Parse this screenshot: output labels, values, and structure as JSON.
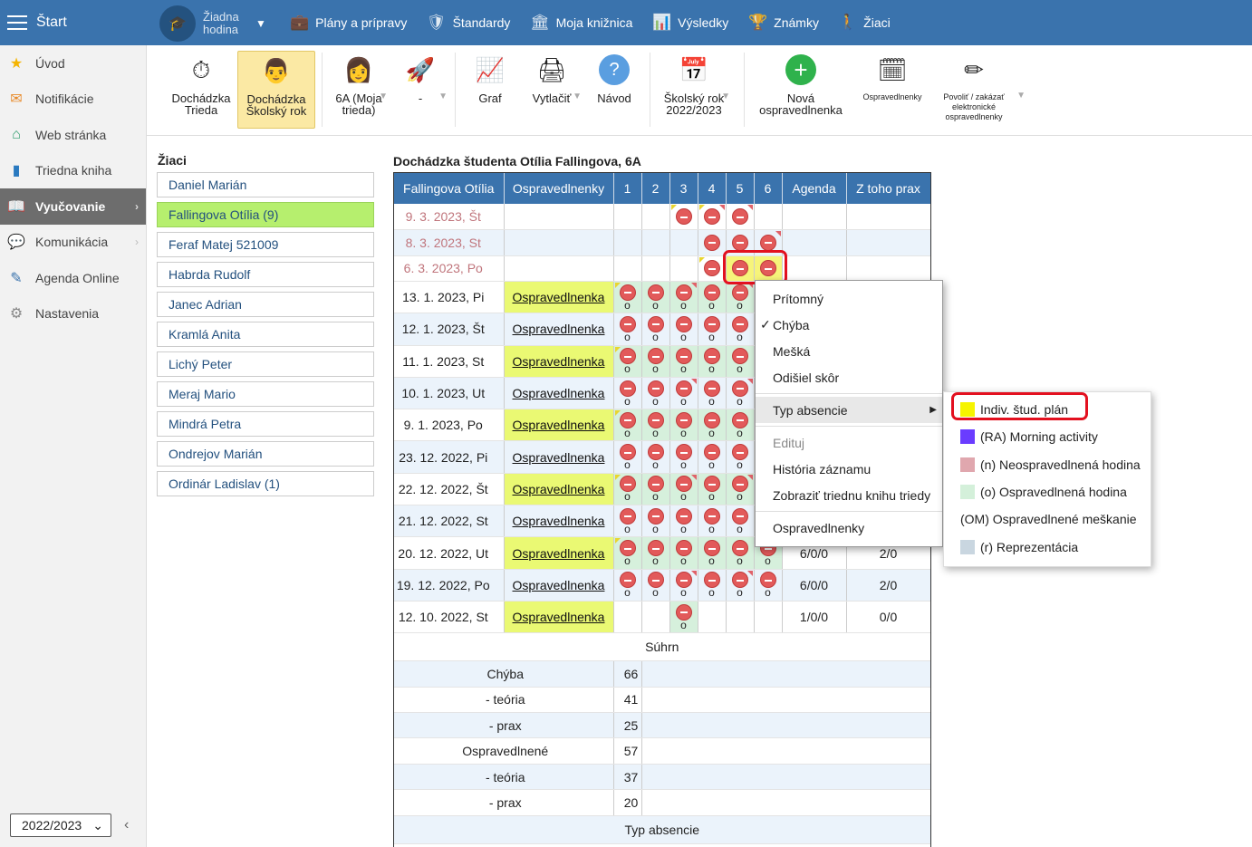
{
  "topbar": {
    "start_label": "Štart",
    "lesson_label": "Žiadna hodina",
    "nav": [
      {
        "label": "Plány a prípravy",
        "icon": "briefcase-icon"
      },
      {
        "label": "Štandardy",
        "icon": "shield-icon"
      },
      {
        "label": "Moja knižnica",
        "icon": "library-icon"
      },
      {
        "label": "Výsledky",
        "icon": "bar-chart-icon"
      },
      {
        "label": "Známky",
        "icon": "grades-icon"
      },
      {
        "label": "Žiaci",
        "icon": "students-icon"
      }
    ]
  },
  "sidebar": {
    "items": [
      {
        "label": "Úvod",
        "icon": "star-icon"
      },
      {
        "label": "Notifikácie",
        "icon": "envelope-icon"
      },
      {
        "label": "Web stránka",
        "icon": "home-icon"
      },
      {
        "label": "Triedna kniha",
        "icon": "book-icon"
      },
      {
        "label": "Vyučovanie",
        "icon": "open-book-icon"
      },
      {
        "label": "Komunikácia",
        "icon": "chat-icon"
      },
      {
        "label": "Agenda Online",
        "icon": "pen-icon"
      },
      {
        "label": "Nastavenia",
        "icon": "gear-icon"
      }
    ],
    "year": "2022/2023"
  },
  "toolbar": {
    "b1": "Dochádzka Trieda",
    "b2": "Dochádzka Školský rok",
    "b3": "6A (Moja trieda)",
    "b4": "-",
    "b5": "Graf",
    "b6": "Vytlačiť",
    "b7": "Návod",
    "b8": "Školský rok 2022/2023",
    "b9": "Nová ospravedlnenka",
    "b10": "Ospravedlnenky",
    "b11": "Povoliť / zakázať elektronické ospravedlnenky"
  },
  "students": {
    "label": "Žiaci",
    "list": [
      "Daniel Marián",
      "Fallingova Otília (9)",
      "Feraf Matej 521009",
      "Habrda Rudolf",
      "Janec Adrian",
      "Kramlá Anita",
      "Lichý Peter",
      "Meraj Mario",
      "Mindrá Petra",
      "Ondrejov Marián",
      "Ordinár Ladislav (1)"
    ]
  },
  "attendance": {
    "title": "Dochádzka študenta Otília Fallingova, 6A",
    "headers": [
      "Fallingova Otília",
      "Ospravedlnenky",
      "1",
      "2",
      "3",
      "4",
      "5",
      "6",
      "Agenda",
      "Z toho prax"
    ],
    "top_dates": [
      "9. 3. 2023, Št",
      "8. 3. 2023, St",
      "6. 3. 2023, Po"
    ],
    "rows": [
      {
        "date": "13. 1. 2023, Pi",
        "osp": "Ospravedlnenka",
        "agenda": "",
        "prax": ""
      },
      {
        "date": "12. 1. 2023, Št",
        "osp": "Ospravedlnenka",
        "agenda": "",
        "prax": ""
      },
      {
        "date": "11. 1. 2023, St",
        "osp": "Ospravedlnenka",
        "agenda": "",
        "prax": ""
      },
      {
        "date": "10. 1. 2023, Ut",
        "osp": "Ospravedlnenka",
        "agenda": "",
        "prax": ""
      },
      {
        "date": "9. 1. 2023, Po",
        "osp": "Ospravedlnenka",
        "agenda": "",
        "prax": ""
      },
      {
        "date": "23. 12. 2022, Pi",
        "osp": "Ospravedlnenka",
        "agenda": "",
        "prax": ""
      },
      {
        "date": "22. 12. 2022, Št",
        "osp": "Ospravedlnenka",
        "agenda": "",
        "prax": ""
      },
      {
        "date": "21. 12. 2022, St",
        "osp": "Ospravedlnenka",
        "agenda": "",
        "prax": ""
      },
      {
        "date": "20. 12. 2022, Ut",
        "osp": "Ospravedlnenka",
        "agenda": "6/0/0",
        "prax": "2/0"
      },
      {
        "date": "19. 12. 2022, Po",
        "osp": "Ospravedlnenka",
        "agenda": "6/0/0",
        "prax": "2/0"
      },
      {
        "date": "12. 10. 2022, St",
        "osp": "Ospravedlnenka",
        "agenda": "1/0/0",
        "prax": "0/0"
      }
    ],
    "mark_letter": "o",
    "summary_title": "Súhrn",
    "summary": [
      {
        "label": "Chýba",
        "value": "66"
      },
      {
        "label": "- teória",
        "value": "41"
      },
      {
        "label": "- prax",
        "value": "25"
      },
      {
        "label": "Ospravedlnené",
        "value": "57"
      },
      {
        "label": "- teória",
        "value": "37"
      },
      {
        "label": "- prax",
        "value": "20"
      }
    ],
    "type_title": "Typ absencie"
  },
  "context_menu": {
    "items": [
      "Prítomný",
      "Chýba",
      "Mešká",
      "Odišiel skôr",
      "Typ absencie",
      "Edituj",
      "História záznamu",
      "Zobraziť triednu knihu triedy",
      "Ospravedlnenky"
    ],
    "check": "✓"
  },
  "submenu": {
    "items": [
      {
        "label": "Indiv. štud. plán",
        "color": "#f6f400"
      },
      {
        "label": "(RA) Morning activity",
        "color": "#6a3cff"
      },
      {
        "label": "(n) Neospravedlnená hodina",
        "color": "#e0a7ae"
      },
      {
        "label": "(o) Ospravedlnená hodina",
        "color": "#d4f0da"
      },
      {
        "label": "(OM) Ospravedlnené meškanie",
        "color": ""
      },
      {
        "label": "(r) Reprezentácia",
        "color": "#c9d6e0"
      }
    ]
  }
}
